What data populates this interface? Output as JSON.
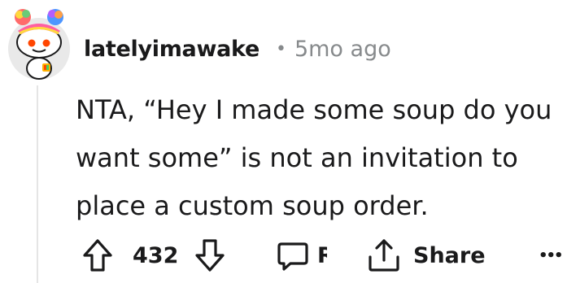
{
  "comment": {
    "author": "latelyimawake",
    "separator": "•",
    "time": "5mo ago",
    "body": "NTA, “Hey I made some soup do you want some” is not an invitation to place a custom soup order.",
    "votes": "432"
  },
  "actions": {
    "reply_label": "Reply",
    "share_label": "Share",
    "more_label": "•••"
  },
  "colors": {
    "text": "#1a1a1b",
    "meta": "#878a8c",
    "thread_line": "#e5e5e5"
  },
  "icons": [
    "snoo-avatar-icon",
    "upvote-arrow-icon",
    "downvote-arrow-icon",
    "comment-bubble-icon",
    "share-icon",
    "more-options-icon"
  ]
}
